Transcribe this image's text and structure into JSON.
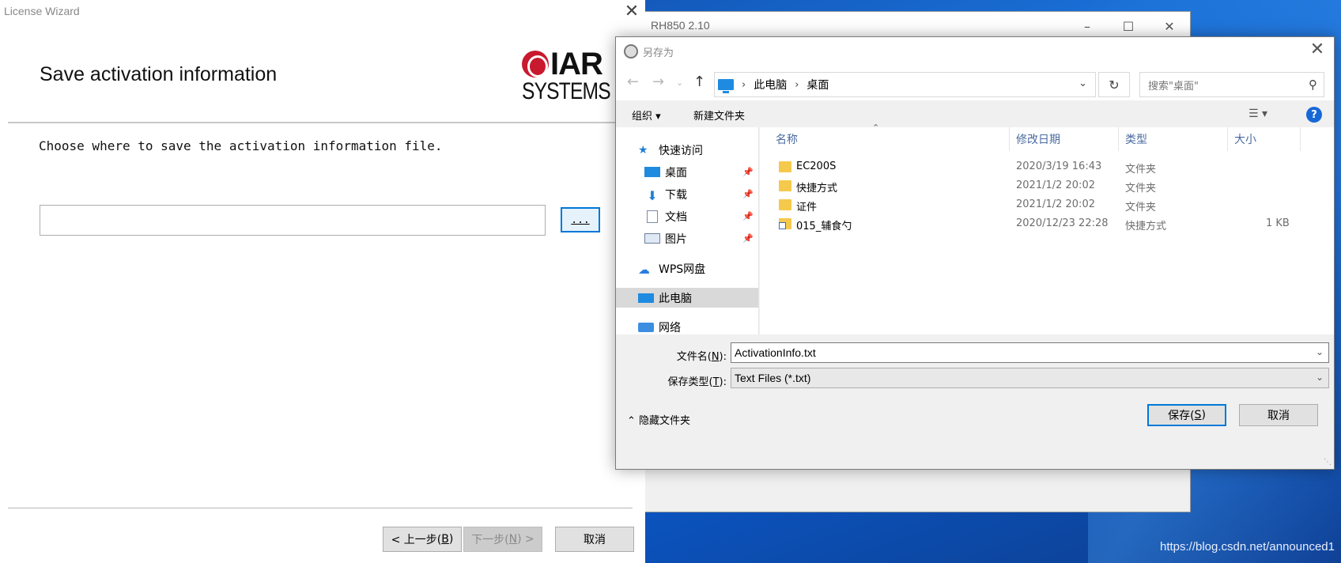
{
  "background_window": {
    "title": "RH850 2.10"
  },
  "wizard": {
    "title": "License Wizard",
    "heading": "Save activation information",
    "description": "Choose where to save the activation information file.",
    "path_value": "",
    "browse_label": "...",
    "logo_text_top": "IAR",
    "logo_text_bottom": "SYSTEMS",
    "back_label_prefix": "< 上一步(",
    "back_key": "B",
    "back_label_suffix": ")",
    "next_label_prefix": "下一步(",
    "next_key": "N",
    "next_label_suffix": ") >",
    "cancel_label": "取消"
  },
  "dialog": {
    "title": "另存为",
    "breadcrumb": [
      "此电脑",
      "桌面"
    ],
    "search_placeholder": "搜索\"桌面\"",
    "toolbar": {
      "organize": "组织 ▾",
      "new_folder": "新建文件夹"
    },
    "nav_items": [
      {
        "label": "快速访问",
        "icon": "star-icon",
        "pinned": false,
        "selected": false
      },
      {
        "label": "桌面",
        "icon": "desktop-icon",
        "pinned": true,
        "selected": false
      },
      {
        "label": "下载",
        "icon": "download-icon",
        "pinned": true,
        "selected": false
      },
      {
        "label": "文档",
        "icon": "document-icon",
        "pinned": true,
        "selected": false
      },
      {
        "label": "图片",
        "icon": "picture-icon",
        "pinned": true,
        "selected": false
      },
      {
        "label": "WPS网盘",
        "icon": "cloud-icon",
        "pinned": false,
        "selected": false
      },
      {
        "label": "此电脑",
        "icon": "computer-icon",
        "pinned": false,
        "selected": true
      },
      {
        "label": "网络",
        "icon": "network-icon",
        "pinned": false,
        "selected": false
      }
    ],
    "columns": {
      "name": "名称",
      "modified": "修改日期",
      "type": "类型",
      "size": "大小"
    },
    "files": [
      {
        "name": "EC200S",
        "modified": "2020/3/19 16:43",
        "type": "文件夹",
        "size": "",
        "icon": "folder-icon"
      },
      {
        "name": "快捷方式",
        "modified": "2021/1/2 20:02",
        "type": "文件夹",
        "size": "",
        "icon": "folder-icon"
      },
      {
        "name": "证件",
        "modified": "2021/1/2 20:02",
        "type": "文件夹",
        "size": "",
        "icon": "folder-icon"
      },
      {
        "name": "015_辅食勺",
        "modified": "2020/12/23 22:28",
        "type": "快捷方式",
        "size": "1 KB",
        "icon": "shortcut-icon"
      }
    ],
    "filename_label_prefix": "文件名(",
    "filename_key": "N",
    "filename_label_suffix": "):",
    "filename_value": "ActivationInfo.txt",
    "filetype_label_prefix": "保存类型(",
    "filetype_key": "T",
    "filetype_label_suffix": "):",
    "filetype_value": "Text Files (*.txt)",
    "hide_folders": "隐藏文件夹",
    "save_prefix": "保存(",
    "save_key": "S",
    "save_suffix": ")",
    "cancel_label": "取消"
  },
  "watermark": "https://blog.csdn.net/announced1"
}
